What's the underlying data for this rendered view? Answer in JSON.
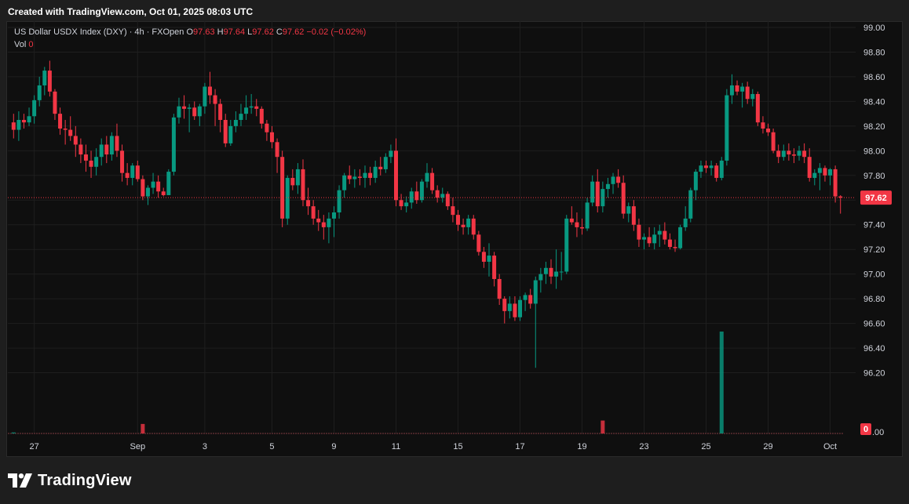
{
  "header": {
    "created_text": "Created with TradingView.com, Oct 01, 2025 08:03 UTC"
  },
  "legend": {
    "symbol": "US Dollar USDX Index (DXY) · 4h · FXOpen",
    "o_label": "O",
    "o_value": "97.63",
    "h_label": "H",
    "h_value": "97.64",
    "l_label": "L",
    "l_value": "97.62",
    "c_label": "C",
    "c_value": "97.62",
    "change": "−0.02 (−0.02%)",
    "vol_label": "Vol",
    "vol_value": "0"
  },
  "footer": {
    "brand": "TradingView"
  },
  "colors": {
    "up": "#089981",
    "down": "#f23645",
    "background": "#0f0f0f",
    "grid": "#1f1f1f",
    "text": "#d1d4dc"
  },
  "chart_data": {
    "type": "candlestick",
    "title": "US Dollar USDX Index (DXY) · 4h · FXOpen",
    "price_axis": {
      "ylim": [
        96.0,
        99.0
      ],
      "ticks": [
        "99.00",
        "98.80",
        "98.60",
        "98.40",
        "98.20",
        "98.00",
        "97.80",
        "97.60",
        "97.40",
        "97.20",
        "97.00",
        "96.80",
        "96.60",
        "96.40",
        "96.20"
      ],
      "current_price": "97.62",
      "volume_label": "0",
      "volume_axis_tail": ".00"
    },
    "time_axis": {
      "labels": [
        {
          "text": "27",
          "index": 4
        },
        {
          "text": "Sep",
          "index": 24
        },
        {
          "text": "3",
          "index": 37
        },
        {
          "text": "5",
          "index": 50
        },
        {
          "text": "9",
          "index": 62
        },
        {
          "text": "11",
          "index": 74
        },
        {
          "text": "15",
          "index": 86
        },
        {
          "text": "17",
          "index": 98
        },
        {
          "text": "19",
          "index": 110
        },
        {
          "text": "23",
          "index": 122
        },
        {
          "text": "25",
          "index": 134
        },
        {
          "text": "29",
          "index": 146
        },
        {
          "text": "Oct",
          "index": 158
        }
      ]
    },
    "grid": true,
    "candles": [
      [
        98.23,
        98.3,
        98.1,
        98.17
      ],
      [
        98.17,
        98.32,
        98.08,
        98.25
      ],
      [
        98.25,
        98.3,
        98.18,
        98.23
      ],
      [
        98.23,
        98.35,
        98.2,
        98.28
      ],
      [
        98.28,
        98.45,
        98.22,
        98.41
      ],
      [
        98.41,
        98.6,
        98.36,
        98.53
      ],
      [
        98.53,
        98.68,
        98.45,
        98.65
      ],
      [
        98.65,
        98.73,
        98.44,
        98.48
      ],
      [
        98.48,
        98.5,
        98.25,
        98.3
      ],
      [
        98.3,
        98.35,
        98.13,
        98.18
      ],
      [
        98.18,
        98.25,
        98.05,
        98.17
      ],
      [
        98.17,
        98.28,
        98.08,
        98.12
      ],
      [
        98.12,
        98.2,
        97.95,
        98.05
      ],
      [
        98.05,
        98.1,
        97.9,
        97.97
      ],
      [
        97.97,
        98.05,
        97.83,
        97.92
      ],
      [
        97.92,
        98.0,
        97.78,
        97.87
      ],
      [
        97.87,
        98.02,
        97.8,
        97.95
      ],
      [
        97.95,
        98.1,
        97.88,
        98.05
      ],
      [
        98.05,
        98.12,
        97.9,
        97.97
      ],
      [
        97.97,
        98.15,
        97.92,
        98.12
      ],
      [
        98.12,
        98.22,
        97.95,
        98.0
      ],
      [
        98.0,
        98.05,
        97.75,
        97.82
      ],
      [
        97.82,
        97.9,
        97.72,
        97.78
      ],
      [
        97.78,
        97.9,
        97.72,
        97.88
      ],
      [
        97.88,
        97.92,
        97.75,
        97.77
      ],
      [
        97.77,
        97.8,
        97.6,
        97.63
      ],
      [
        97.63,
        97.72,
        97.56,
        97.7
      ],
      [
        97.7,
        97.82,
        97.65,
        97.75
      ],
      [
        97.75,
        97.8,
        97.62,
        97.67
      ],
      [
        97.67,
        97.7,
        97.63,
        97.64
      ],
      [
        97.64,
        97.85,
        97.64,
        97.83
      ],
      [
        97.83,
        98.3,
        97.8,
        98.27
      ],
      [
        98.27,
        98.43,
        98.22,
        98.36
      ],
      [
        98.36,
        98.45,
        98.26,
        98.34
      ],
      [
        98.34,
        98.38,
        98.15,
        98.35
      ],
      [
        98.35,
        98.4,
        98.25,
        98.28
      ],
      [
        98.28,
        98.38,
        98.2,
        98.36
      ],
      [
        98.36,
        98.55,
        98.3,
        98.52
      ],
      [
        98.52,
        98.64,
        98.38,
        98.45
      ],
      [
        98.45,
        98.5,
        98.2,
        98.38
      ],
      [
        98.38,
        98.42,
        98.15,
        98.25
      ],
      [
        98.25,
        98.3,
        98.03,
        98.06
      ],
      [
        98.06,
        98.25,
        98.04,
        98.2
      ],
      [
        98.2,
        98.32,
        98.15,
        98.25
      ],
      [
        98.25,
        98.38,
        98.2,
        98.3
      ],
      [
        98.3,
        98.45,
        98.25,
        98.35
      ],
      [
        98.35,
        98.46,
        98.3,
        98.36
      ],
      [
        98.36,
        98.42,
        98.28,
        98.34
      ],
      [
        98.34,
        98.36,
        98.18,
        98.22
      ],
      [
        98.22,
        98.25,
        98.08,
        98.15
      ],
      [
        98.15,
        98.2,
        98.02,
        98.07
      ],
      [
        98.07,
        98.1,
        97.82,
        97.95
      ],
      [
        97.95,
        98.0,
        97.38,
        97.45
      ],
      [
        97.45,
        97.8,
        97.4,
        97.78
      ],
      [
        97.78,
        97.85,
        97.68,
        97.72
      ],
      [
        97.72,
        97.9,
        97.65,
        97.85
      ],
      [
        97.85,
        97.93,
        97.55,
        97.6
      ],
      [
        97.6,
        97.7,
        97.48,
        97.55
      ],
      [
        97.55,
        97.6,
        97.4,
        97.45
      ],
      [
        97.45,
        97.52,
        97.35,
        97.42
      ],
      [
        97.42,
        97.48,
        97.28,
        97.38
      ],
      [
        97.38,
        97.5,
        97.25,
        97.45
      ],
      [
        97.45,
        97.55,
        97.3,
        97.5
      ],
      [
        97.5,
        97.72,
        97.45,
        97.68
      ],
      [
        97.68,
        97.82,
        97.62,
        97.8
      ],
      [
        97.8,
        97.88,
        97.73,
        97.77
      ],
      [
        97.77,
        97.85,
        97.7,
        97.79
      ],
      [
        97.79,
        97.85,
        97.72,
        97.78
      ],
      [
        97.78,
        97.88,
        97.7,
        97.82
      ],
      [
        97.82,
        97.87,
        97.72,
        97.78
      ],
      [
        97.78,
        97.92,
        97.74,
        97.87
      ],
      [
        97.87,
        97.95,
        97.8,
        97.85
      ],
      [
        97.85,
        97.98,
        97.82,
        97.95
      ],
      [
        97.95,
        98.05,
        97.9,
        98.0
      ],
      [
        98.0,
        98.1,
        97.55,
        97.6
      ],
      [
        97.6,
        97.65,
        97.52,
        97.55
      ],
      [
        97.55,
        97.63,
        97.5,
        97.58
      ],
      [
        97.58,
        97.7,
        97.53,
        97.67
      ],
      [
        97.67,
        97.75,
        97.57,
        97.6
      ],
      [
        97.6,
        97.77,
        97.58,
        97.75
      ],
      [
        97.75,
        97.9,
        97.7,
        97.82
      ],
      [
        97.82,
        97.86,
        97.65,
        97.68
      ],
      [
        97.68,
        97.72,
        97.58,
        97.62
      ],
      [
        97.62,
        97.7,
        97.58,
        97.65
      ],
      [
        97.65,
        97.67,
        97.52,
        97.55
      ],
      [
        97.55,
        97.62,
        97.42,
        97.48
      ],
      [
        97.48,
        97.52,
        97.35,
        97.4
      ],
      [
        97.4,
        97.45,
        97.32,
        97.38
      ],
      [
        97.38,
        97.48,
        97.32,
        97.45
      ],
      [
        97.45,
        97.48,
        97.28,
        97.32
      ],
      [
        97.32,
        97.35,
        97.15,
        97.18
      ],
      [
        97.18,
        97.22,
        97.05,
        97.1
      ],
      [
        97.1,
        97.25,
        96.98,
        97.15
      ],
      [
        97.15,
        97.18,
        96.9,
        96.96
      ],
      [
        96.96,
        97.0,
        96.75,
        96.8
      ],
      [
        96.8,
        96.82,
        96.6,
        96.7
      ],
      [
        96.7,
        96.82,
        96.64,
        96.76
      ],
      [
        96.76,
        96.82,
        96.62,
        96.65
      ],
      [
        96.65,
        96.82,
        96.62,
        96.79
      ],
      [
        96.79,
        96.85,
        96.7,
        96.83
      ],
      [
        96.83,
        96.88,
        96.72,
        96.76
      ],
      [
        96.76,
        96.98,
        96.24,
        96.95
      ],
      [
        96.95,
        97.05,
        96.85,
        97.0
      ],
      [
        97.0,
        97.1,
        96.92,
        97.05
      ],
      [
        97.05,
        97.12,
        96.92,
        96.98
      ],
      [
        96.98,
        97.2,
        96.88,
        97.02
      ],
      [
        97.02,
        97.18,
        96.95,
        97.02
      ],
      [
        97.02,
        97.48,
        97.0,
        97.45
      ],
      [
        97.45,
        97.55,
        97.4,
        97.42
      ],
      [
        97.42,
        97.5,
        97.3,
        97.38
      ],
      [
        97.38,
        97.45,
        97.32,
        97.37
      ],
      [
        97.37,
        97.62,
        97.35,
        97.58
      ],
      [
        97.58,
        97.8,
        97.55,
        97.75
      ],
      [
        97.75,
        97.85,
        97.5,
        97.55
      ],
      [
        97.55,
        97.75,
        97.5,
        97.69
      ],
      [
        97.69,
        97.78,
        97.62,
        97.73
      ],
      [
        97.73,
        97.82,
        97.65,
        97.79
      ],
      [
        97.79,
        97.85,
        97.7,
        97.74
      ],
      [
        97.74,
        97.8,
        97.45,
        97.49
      ],
      [
        97.49,
        97.58,
        97.42,
        97.55
      ],
      [
        97.55,
        97.6,
        97.35,
        97.4
      ],
      [
        97.4,
        97.45,
        97.22,
        97.28
      ],
      [
        97.28,
        97.33,
        97.2,
        97.3
      ],
      [
        97.3,
        97.38,
        97.22,
        97.25
      ],
      [
        97.25,
        97.38,
        97.2,
        97.32
      ],
      [
        97.32,
        97.4,
        97.22,
        97.35
      ],
      [
        97.35,
        97.42,
        97.24,
        97.28
      ],
      [
        97.28,
        97.33,
        97.2,
        97.22
      ],
      [
        97.22,
        97.28,
        97.18,
        97.21
      ],
      [
        97.21,
        97.4,
        97.2,
        97.38
      ],
      [
        97.38,
        97.55,
        97.35,
        97.45
      ],
      [
        97.45,
        97.7,
        97.42,
        97.68
      ],
      [
        97.68,
        97.85,
        97.6,
        97.83
      ],
      [
        97.83,
        97.92,
        97.78,
        97.88
      ],
      [
        97.88,
        97.92,
        97.82,
        97.86
      ],
      [
        97.86,
        97.92,
        97.8,
        97.88
      ],
      [
        97.88,
        97.9,
        97.75,
        97.78
      ],
      [
        97.78,
        97.95,
        97.76,
        97.92
      ],
      [
        97.92,
        98.5,
        97.88,
        98.45
      ],
      [
        98.45,
        98.62,
        98.38,
        98.53
      ],
      [
        98.53,
        98.57,
        98.45,
        98.48
      ],
      [
        98.48,
        98.55,
        98.35,
        98.52
      ],
      [
        98.52,
        98.56,
        98.38,
        98.42
      ],
      [
        98.42,
        98.5,
        98.36,
        98.46
      ],
      [
        98.46,
        98.48,
        98.2,
        98.23
      ],
      [
        98.23,
        98.28,
        98.14,
        98.18
      ],
      [
        98.18,
        98.22,
        98.12,
        98.15
      ],
      [
        98.15,
        98.18,
        97.98,
        98.0
      ],
      [
        98.0,
        98.05,
        97.9,
        97.95
      ],
      [
        97.95,
        98.05,
        97.92,
        98.0
      ],
      [
        98.0,
        98.06,
        97.92,
        97.97
      ],
      [
        97.97,
        98.02,
        97.9,
        97.96
      ],
      [
        97.96,
        98.04,
        97.92,
        98.0
      ],
      [
        98.0,
        98.06,
        97.9,
        97.95
      ],
      [
        97.95,
        98.02,
        97.75,
        97.78
      ],
      [
        97.78,
        97.85,
        97.72,
        97.82
      ],
      [
        97.82,
        97.9,
        97.68,
        97.86
      ],
      [
        97.86,
        97.88,
        97.75,
        97.8
      ],
      [
        97.8,
        97.86,
        97.72,
        97.85
      ],
      [
        97.85,
        97.88,
        97.58,
        97.63
      ],
      [
        97.63,
        97.64,
        97.49,
        97.62
      ]
    ],
    "volume": [
      {
        "index": 0,
        "value": 0.3,
        "up": true
      },
      {
        "index": 25,
        "value": 2.8,
        "up": false
      },
      {
        "index": 114,
        "value": 3.8,
        "up": false
      },
      {
        "index": 137,
        "value": 30.0,
        "up": true
      }
    ]
  }
}
